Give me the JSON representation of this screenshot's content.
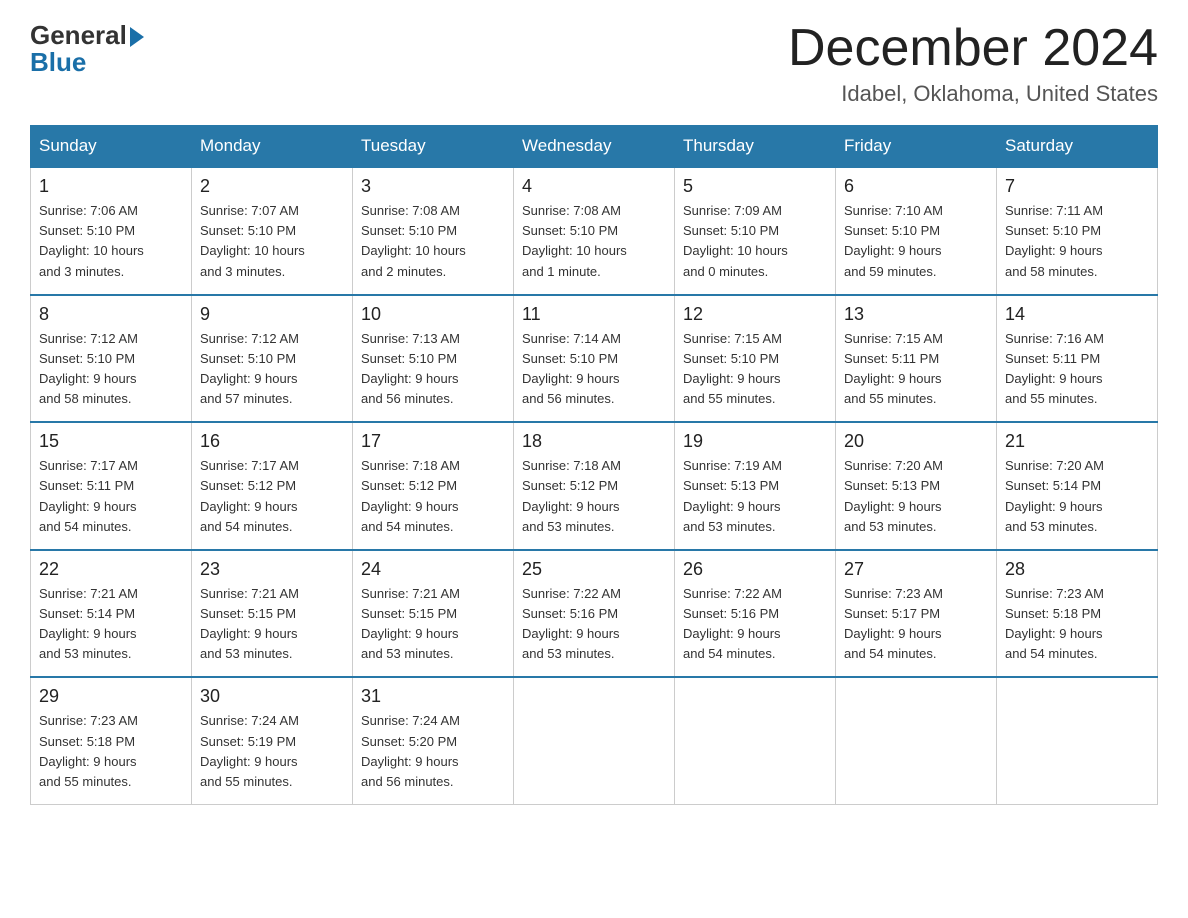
{
  "logo": {
    "general": "General",
    "blue": "Blue"
  },
  "header": {
    "month": "December 2024",
    "location": "Idabel, Oklahoma, United States"
  },
  "days_of_week": [
    "Sunday",
    "Monday",
    "Tuesday",
    "Wednesday",
    "Thursday",
    "Friday",
    "Saturday"
  ],
  "weeks": [
    [
      {
        "day": "1",
        "sunrise": "7:06 AM",
        "sunset": "5:10 PM",
        "daylight": "10 hours and 3 minutes."
      },
      {
        "day": "2",
        "sunrise": "7:07 AM",
        "sunset": "5:10 PM",
        "daylight": "10 hours and 3 minutes."
      },
      {
        "day": "3",
        "sunrise": "7:08 AM",
        "sunset": "5:10 PM",
        "daylight": "10 hours and 2 minutes."
      },
      {
        "day": "4",
        "sunrise": "7:08 AM",
        "sunset": "5:10 PM",
        "daylight": "10 hours and 1 minute."
      },
      {
        "day": "5",
        "sunrise": "7:09 AM",
        "sunset": "5:10 PM",
        "daylight": "10 hours and 0 minutes."
      },
      {
        "day": "6",
        "sunrise": "7:10 AM",
        "sunset": "5:10 PM",
        "daylight": "9 hours and 59 minutes."
      },
      {
        "day": "7",
        "sunrise": "7:11 AM",
        "sunset": "5:10 PM",
        "daylight": "9 hours and 58 minutes."
      }
    ],
    [
      {
        "day": "8",
        "sunrise": "7:12 AM",
        "sunset": "5:10 PM",
        "daylight": "9 hours and 58 minutes."
      },
      {
        "day": "9",
        "sunrise": "7:12 AM",
        "sunset": "5:10 PM",
        "daylight": "9 hours and 57 minutes."
      },
      {
        "day": "10",
        "sunrise": "7:13 AM",
        "sunset": "5:10 PM",
        "daylight": "9 hours and 56 minutes."
      },
      {
        "day": "11",
        "sunrise": "7:14 AM",
        "sunset": "5:10 PM",
        "daylight": "9 hours and 56 minutes."
      },
      {
        "day": "12",
        "sunrise": "7:15 AM",
        "sunset": "5:10 PM",
        "daylight": "9 hours and 55 minutes."
      },
      {
        "day": "13",
        "sunrise": "7:15 AM",
        "sunset": "5:11 PM",
        "daylight": "9 hours and 55 minutes."
      },
      {
        "day": "14",
        "sunrise": "7:16 AM",
        "sunset": "5:11 PM",
        "daylight": "9 hours and 55 minutes."
      }
    ],
    [
      {
        "day": "15",
        "sunrise": "7:17 AM",
        "sunset": "5:11 PM",
        "daylight": "9 hours and 54 minutes."
      },
      {
        "day": "16",
        "sunrise": "7:17 AM",
        "sunset": "5:12 PM",
        "daylight": "9 hours and 54 minutes."
      },
      {
        "day": "17",
        "sunrise": "7:18 AM",
        "sunset": "5:12 PM",
        "daylight": "9 hours and 54 minutes."
      },
      {
        "day": "18",
        "sunrise": "7:18 AM",
        "sunset": "5:12 PM",
        "daylight": "9 hours and 53 minutes."
      },
      {
        "day": "19",
        "sunrise": "7:19 AM",
        "sunset": "5:13 PM",
        "daylight": "9 hours and 53 minutes."
      },
      {
        "day": "20",
        "sunrise": "7:20 AM",
        "sunset": "5:13 PM",
        "daylight": "9 hours and 53 minutes."
      },
      {
        "day": "21",
        "sunrise": "7:20 AM",
        "sunset": "5:14 PM",
        "daylight": "9 hours and 53 minutes."
      }
    ],
    [
      {
        "day": "22",
        "sunrise": "7:21 AM",
        "sunset": "5:14 PM",
        "daylight": "9 hours and 53 minutes."
      },
      {
        "day": "23",
        "sunrise": "7:21 AM",
        "sunset": "5:15 PM",
        "daylight": "9 hours and 53 minutes."
      },
      {
        "day": "24",
        "sunrise": "7:21 AM",
        "sunset": "5:15 PM",
        "daylight": "9 hours and 53 minutes."
      },
      {
        "day": "25",
        "sunrise": "7:22 AM",
        "sunset": "5:16 PM",
        "daylight": "9 hours and 53 minutes."
      },
      {
        "day": "26",
        "sunrise": "7:22 AM",
        "sunset": "5:16 PM",
        "daylight": "9 hours and 54 minutes."
      },
      {
        "day": "27",
        "sunrise": "7:23 AM",
        "sunset": "5:17 PM",
        "daylight": "9 hours and 54 minutes."
      },
      {
        "day": "28",
        "sunrise": "7:23 AM",
        "sunset": "5:18 PM",
        "daylight": "9 hours and 54 minutes."
      }
    ],
    [
      {
        "day": "29",
        "sunrise": "7:23 AM",
        "sunset": "5:18 PM",
        "daylight": "9 hours and 55 minutes."
      },
      {
        "day": "30",
        "sunrise": "7:24 AM",
        "sunset": "5:19 PM",
        "daylight": "9 hours and 55 minutes."
      },
      {
        "day": "31",
        "sunrise": "7:24 AM",
        "sunset": "5:20 PM",
        "daylight": "9 hours and 56 minutes."
      },
      null,
      null,
      null,
      null
    ]
  ],
  "labels": {
    "sunrise": "Sunrise:",
    "sunset": "Sunset:",
    "daylight": "Daylight:"
  }
}
